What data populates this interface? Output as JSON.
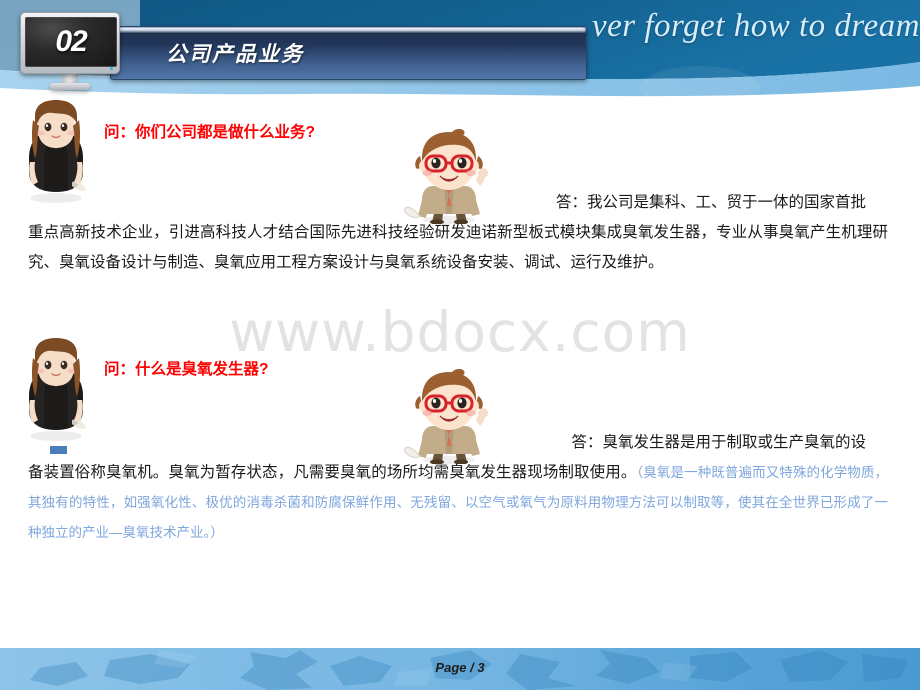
{
  "slide": {
    "number_badge": "02",
    "title": "公司产品业务",
    "header_script": "ver forget   how to dream",
    "watermark": "www.bdocx.com"
  },
  "qa": [
    {
      "question": "问：你们公司都是做什么业务?",
      "answer_lead": "答：我公司是集科、工、贸于一体的国家首批",
      "answer_body": "重点高新技术企业，引进高科技人才结合国际先进科技经验研发迪诺新型板式模块集成臭氧发生器，专业从事臭氧产生机理研究、臭氧设备设计与制造、臭氧应用工程方案设计与臭氧系统设备安装、调试、运行及维护。"
    },
    {
      "question": "问：什么是臭氧发生器?",
      "answer_lead": "答：臭氧发生器是用于制取或生产臭氧的设",
      "answer_body": "备装置俗称臭氧机。臭氧为暂存状态，凡需要臭氧的场所均需臭氧发生器现场制取使用。",
      "answer_note": "（臭氧是一种既普遍而又特殊的化学物质，其独有的特性，如强氧化性、极优的消毒杀菌和防腐保鲜作用、无残留、以空气或氧气为原料用物理方法可以制取等，使其在全世界已形成了一种独立的产业—臭氧技术产业。）"
    }
  ],
  "footer": {
    "page_label": "Page / 3"
  },
  "colors": {
    "header_dark_blue": "#14618f",
    "header_light_blue": "#8ec4e8",
    "title_bar_dark": "#22365b",
    "question_red": "#ff0000",
    "note_blue": "#7fa6dd",
    "footer_blue": "#76b6e2",
    "watermark_gray": "#e3e3e3"
  }
}
